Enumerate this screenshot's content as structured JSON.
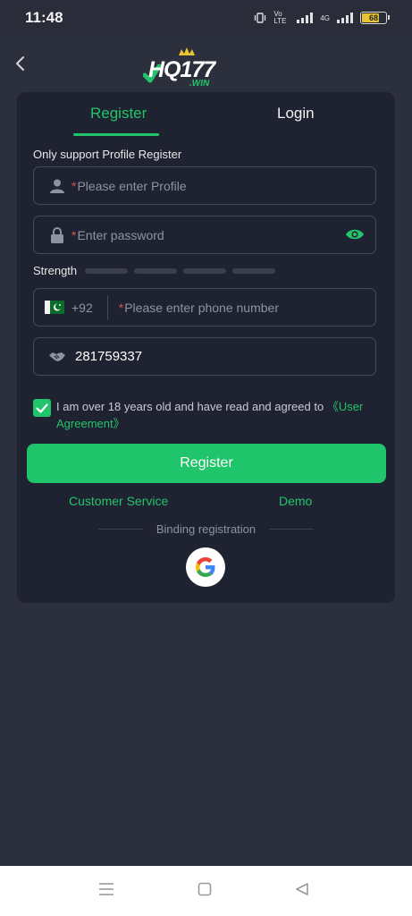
{
  "status_bar": {
    "time": "11:48",
    "battery": "68",
    "network_label": "4G",
    "volte_label": "Vo LTE"
  },
  "header": {
    "back_icon": "chevron-left-icon",
    "logo_text": "HQ177",
    "logo_sub": ".WIN"
  },
  "tabs": {
    "register": "Register",
    "login": "Login",
    "active": "register"
  },
  "form": {
    "hint": "Only support Profile Register",
    "profile_placeholder": "Please enter Profile",
    "password_placeholder": "Enter password",
    "required_mark": "*",
    "strength_label": "Strength",
    "country_code": "+92",
    "phone_placeholder": "Please enter phone number",
    "invite_code": "281759337",
    "agree_text": "I am over 18 years old and have read and agreed to ",
    "agree_link": "《User Agreement》",
    "register_button": "Register",
    "customer_service": "Customer Service",
    "demo": "Demo",
    "binding_text": "Binding registration"
  },
  "colors": {
    "accent": "#22c46b",
    "background": "#2c2f3c",
    "card": "#1f2230",
    "required": "#e34c4c"
  }
}
